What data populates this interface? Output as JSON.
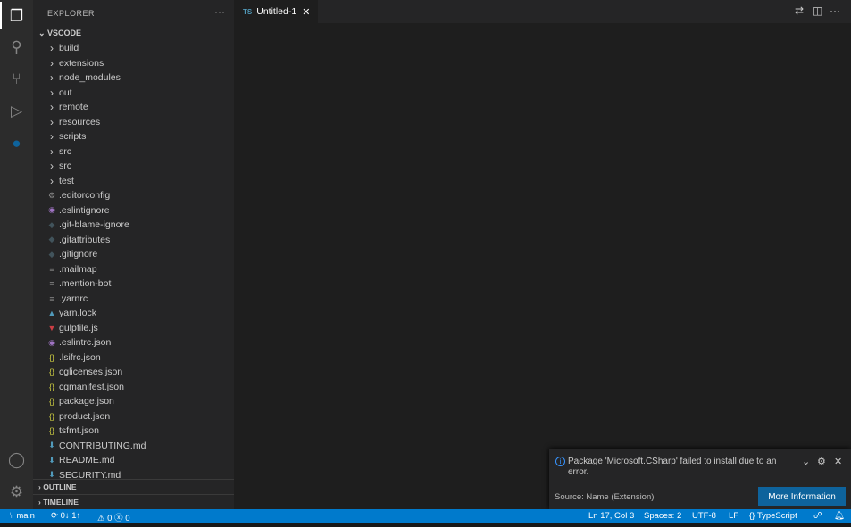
{
  "activity": {
    "items": [
      "explorer-icon",
      "search-icon",
      "source-control-icon",
      "run-debug-icon",
      "remote-explorer-icon"
    ],
    "bottom": [
      "account-icon",
      "settings-gear-icon"
    ]
  },
  "sidebar": {
    "title": "EXPLORER",
    "more": "···",
    "root": "VSCODE",
    "items": [
      {
        "label": "build",
        "type": "folder"
      },
      {
        "label": "extensions",
        "type": "folder"
      },
      {
        "label": "node_modules",
        "type": "folder"
      },
      {
        "label": "out",
        "type": "folder"
      },
      {
        "label": "remote",
        "type": "folder"
      },
      {
        "label": "resources",
        "type": "folder"
      },
      {
        "label": "scripts",
        "type": "folder"
      },
      {
        "label": "src",
        "type": "folder"
      },
      {
        "label": "src",
        "type": "folder"
      },
      {
        "label": "test",
        "type": "folder"
      },
      {
        "label": ".editorconfig",
        "icon": "⚙",
        "color": "#8b8b8b"
      },
      {
        "label": ".eslintignore",
        "icon": "◉",
        "color": "#a074c4"
      },
      {
        "label": ".git-blame-ignore",
        "icon": "◆",
        "color": "#41535b"
      },
      {
        "label": ".gitattributes",
        "icon": "◆",
        "color": "#41535b"
      },
      {
        "label": ".gitignore",
        "icon": "◆",
        "color": "#41535b"
      },
      {
        "label": ".mailmap",
        "icon": "≡",
        "color": "#8b8b8b"
      },
      {
        "label": ".mention-bot",
        "icon": "≡",
        "color": "#8b8b8b"
      },
      {
        "label": ".yarnrc",
        "icon": "≡",
        "color": "#8b8b8b"
      },
      {
        "label": "yarn.lock",
        "icon": "▲",
        "color": "#519aba"
      },
      {
        "label": "gulpfile.js",
        "icon": "▼",
        "color": "#cc3e44"
      },
      {
        "label": ".eslintrc.json",
        "icon": "◉",
        "color": "#a074c4"
      },
      {
        "label": ".lsifrc.json",
        "icon": "{}",
        "color": "#cbcb41"
      },
      {
        "label": "cglicenses.json",
        "icon": "{}",
        "color": "#cbcb41"
      },
      {
        "label": "cgmanifest.json",
        "icon": "{}",
        "color": "#cbcb41"
      },
      {
        "label": "package.json",
        "icon": "{}",
        "color": "#cbcb41"
      },
      {
        "label": "product.json",
        "icon": "{}",
        "color": "#cbcb41"
      },
      {
        "label": "tsfmt.json",
        "icon": "{}",
        "color": "#cbcb41"
      },
      {
        "label": "CONTRIBUTING.md",
        "icon": "⬇",
        "color": "#519aba"
      },
      {
        "label": "README.md",
        "icon": "⬇",
        "color": "#519aba"
      },
      {
        "label": "SECURITY.md",
        "icon": "⬇",
        "color": "#519aba"
      }
    ],
    "outline": "OUTLINE",
    "timeline": "TIMELINE"
  },
  "editor": {
    "tab": {
      "lang": "TS",
      "title": "Untitled-1"
    }
  },
  "notification": {
    "message": "Package 'Microsoft.CSharp' failed to install due to an error.",
    "source": "Source: Name (Extension)",
    "button": "More Information"
  },
  "status": {
    "branch": "main",
    "sync": "0↓ 1↑",
    "warnings": "0",
    "errors": "0",
    "position": "Ln 17, Col 3",
    "spaces": "Spaces: 2",
    "encoding": "UTF-8",
    "eol": "LF",
    "language": "TypeScript",
    "color": "#007acc"
  }
}
